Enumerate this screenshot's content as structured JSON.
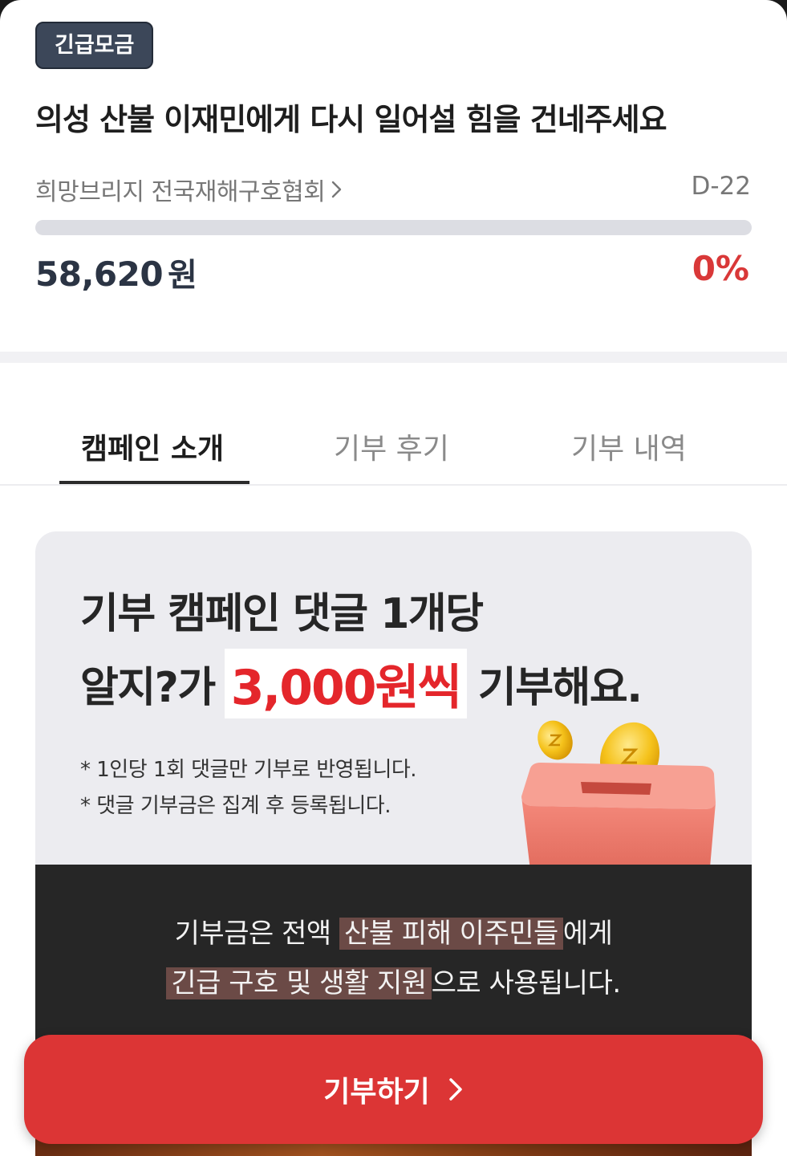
{
  "campaign": {
    "badge": "긴급모금",
    "title": "의성 산불 이재민에게 다시 일어설 힘을 건네주세요",
    "organization": "희망브리지 전국재해구호협회",
    "dday": "D-22",
    "progress_fraction": 0,
    "amount": "58,620",
    "amount_unit": "원",
    "percent": "0%"
  },
  "tabs": [
    {
      "label": "캠페인 소개",
      "active": true
    },
    {
      "label": "기부 후기",
      "active": false
    },
    {
      "label": "기부 내역",
      "active": false
    }
  ],
  "promo": {
    "line1": "기부 캠페인 댓글 1개당",
    "line2_prefix": "알지?가",
    "line2_highlight": "3,000원씩",
    "line2_suffix": "기부해요.",
    "note1": "* 1인당 1회 댓글만 기부로 반영됩니다.",
    "note2": "* 댓글 기부금은 집계 후 등록됩니다.",
    "illustration": "coins-donation-box-icon"
  },
  "info": {
    "line1_prefix": "기부금은 전액 ",
    "line1_highlight": "산불 피해 이주민들",
    "line1_suffix": "에게",
    "line2_highlight": "긴급 구호 및 생활 지원",
    "line2_suffix": "으로 사용됩니다."
  },
  "cta": {
    "label": "기부하기"
  },
  "colors": {
    "accent": "#dc3535",
    "badge_bg": "#3c4759",
    "amount_text": "#2b3444",
    "card_bg": "#ececf0",
    "dark_bg": "#262626"
  }
}
